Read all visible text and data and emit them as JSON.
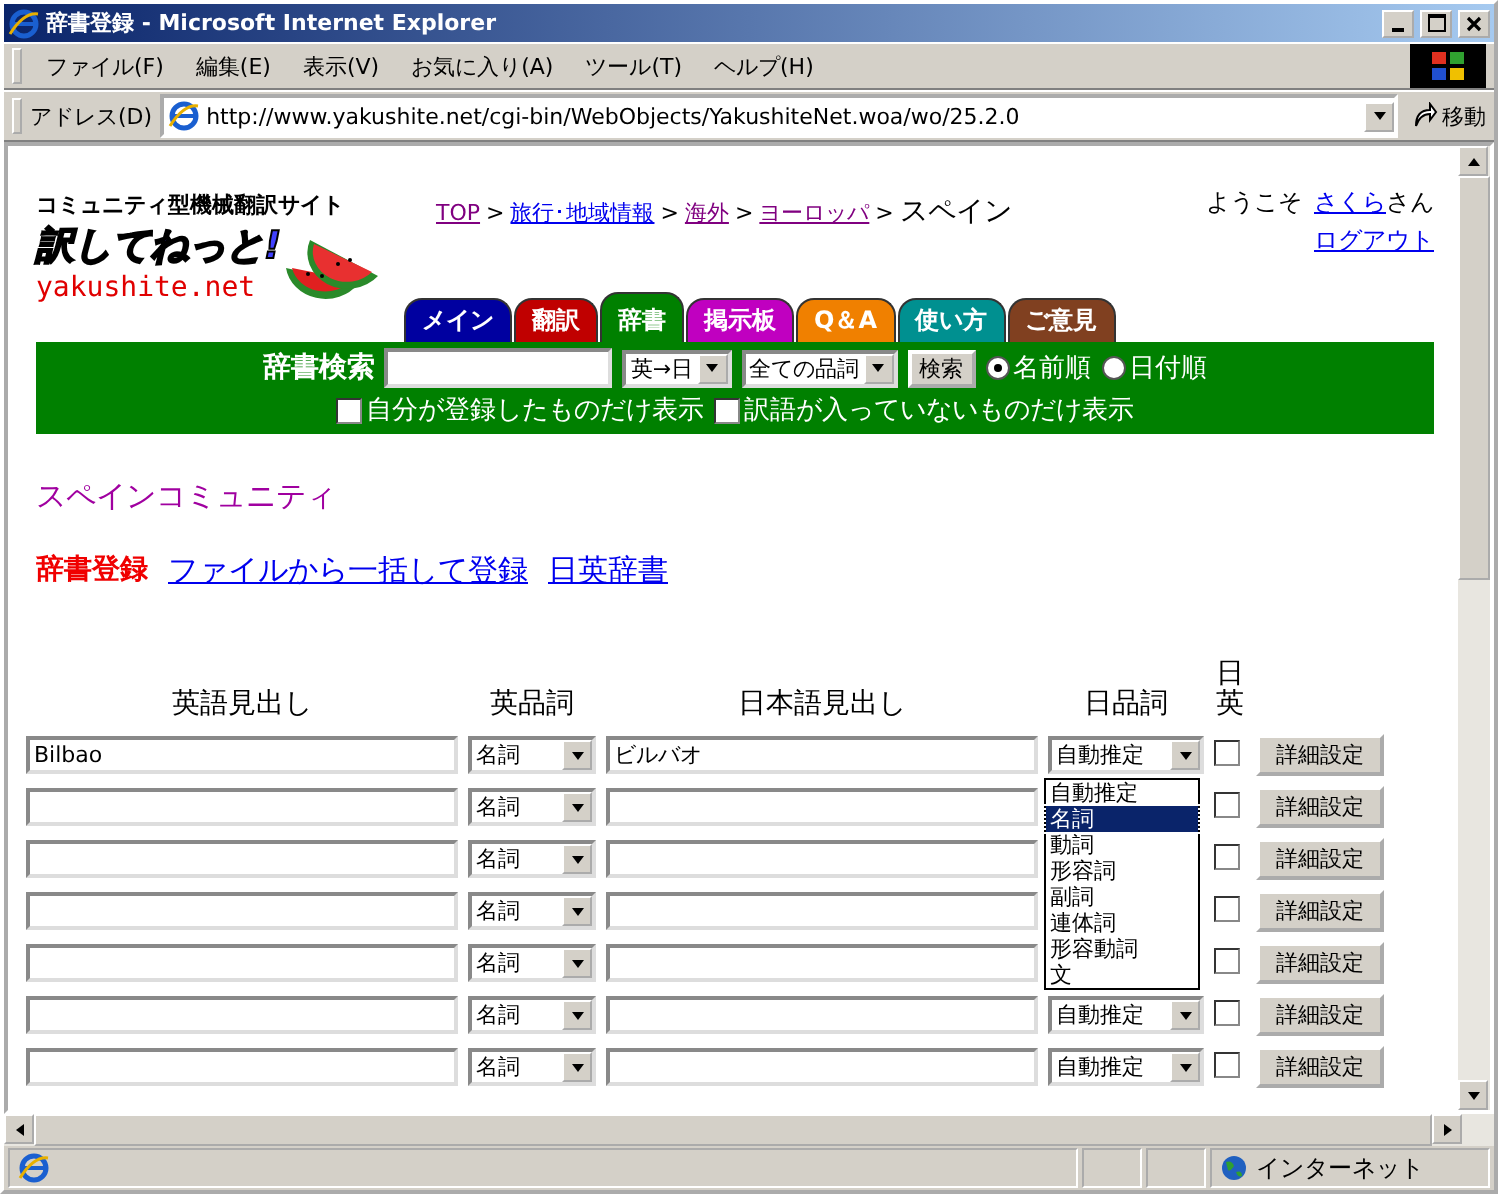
{
  "window": {
    "title": "辞書登録 - Microsoft Internet Explorer"
  },
  "menu": [
    "ファイル(F)",
    "編集(E)",
    "表示(V)",
    "お気に入り(A)",
    "ツール(T)",
    "ヘルプ(H)"
  ],
  "address": {
    "label": "アドレス(D)",
    "value": "http://www.yakushite.net/cgi-bin/WebObjects/YakushiteNet.woa/wo/25.2.0",
    "go": "移動"
  },
  "site": {
    "tagline": "コミュニティ型機械翻訳サイト",
    "logo": "訳してねっと!",
    "domain": "yakushite.net"
  },
  "breadcrumb": [
    {
      "label": "TOP",
      "visited": true
    },
    {
      "label": "旅行･地域情報",
      "visited": false
    },
    {
      "label": "海外",
      "visited": true
    },
    {
      "label": "ヨーロッパ",
      "visited": true
    }
  ],
  "breadcrumb_separator": ">",
  "breadcrumb_current": "スペイン",
  "user": {
    "greeting": "ようこそ",
    "name": "さくら",
    "suffix": "さん",
    "logout": "ログアウト"
  },
  "tabs": [
    {
      "label": "メイン",
      "color": "#0000a0",
      "selected": false
    },
    {
      "label": "翻訳",
      "color": "#c00000",
      "selected": false
    },
    {
      "label": "辞書",
      "color": "#008000",
      "selected": true
    },
    {
      "label": "掲示板",
      "color": "#c000c0",
      "selected": false
    },
    {
      "label": "Q＆A",
      "color": "#f08000",
      "selected": false
    },
    {
      "label": "使い方",
      "color": "#009090",
      "selected": false
    },
    {
      "label": "ご意見",
      "color": "#804020",
      "selected": false
    }
  ],
  "search": {
    "label": "辞書検索",
    "direction": "英→日",
    "pos": "全ての品詞",
    "button": "検索",
    "sort": [
      {
        "label": "名前順",
        "selected": true
      },
      {
        "label": "日付順",
        "selected": false
      }
    ],
    "filters": [
      {
        "label": "自分が登録したものだけ表示",
        "checked": false
      },
      {
        "label": "訳語が入っていないものだけ表示",
        "checked": false
      }
    ]
  },
  "community": "スペインコミュニティ",
  "nav": [
    {
      "label": "辞書登録",
      "kind": "current"
    },
    {
      "label": "ファイルから一括して登録",
      "kind": "link"
    },
    {
      "label": "日英辞書",
      "kind": "link"
    }
  ],
  "table": {
    "columns": [
      "英語見出し",
      "英品詞",
      "日本語見出し",
      "日品詞",
      "日英"
    ],
    "rows": [
      {
        "english": "Bilbao",
        "en_pos": "名詞",
        "japanese": "ビルバオ",
        "ja_pos": "自動推定",
        "checked": false,
        "button": "詳細設定"
      },
      {
        "english": "",
        "en_pos": "名詞",
        "japanese": "",
        "checked": false,
        "button": "詳細設定"
      },
      {
        "english": "",
        "en_pos": "名詞",
        "japanese": "",
        "checked": false,
        "button": "詳細設定"
      },
      {
        "english": "",
        "en_pos": "名詞",
        "japanese": "",
        "checked": false,
        "button": "詳細設定"
      },
      {
        "english": "",
        "en_pos": "名詞",
        "japanese": "",
        "checked": false,
        "button": "詳細設定"
      },
      {
        "english": "",
        "en_pos": "名詞",
        "japanese": "",
        "ja_pos": "自動推定",
        "checked": false,
        "button": "詳細設定"
      },
      {
        "english": "",
        "en_pos": "名詞",
        "japanese": "",
        "ja_pos": "自動推定",
        "checked": false,
        "button": "詳細設定"
      }
    ]
  },
  "dropdown": [
    {
      "label": "自動推定",
      "selected": false
    },
    {
      "label": "名詞",
      "selected": true
    },
    {
      "label": "動詞",
      "selected": false
    },
    {
      "label": "形容詞",
      "selected": false
    },
    {
      "label": "副詞",
      "selected": false
    },
    {
      "label": "連体詞",
      "selected": false
    },
    {
      "label": "形容動詞",
      "selected": false
    },
    {
      "label": "文",
      "selected": false
    }
  ],
  "status_bar": {
    "zone": "インターネット"
  }
}
